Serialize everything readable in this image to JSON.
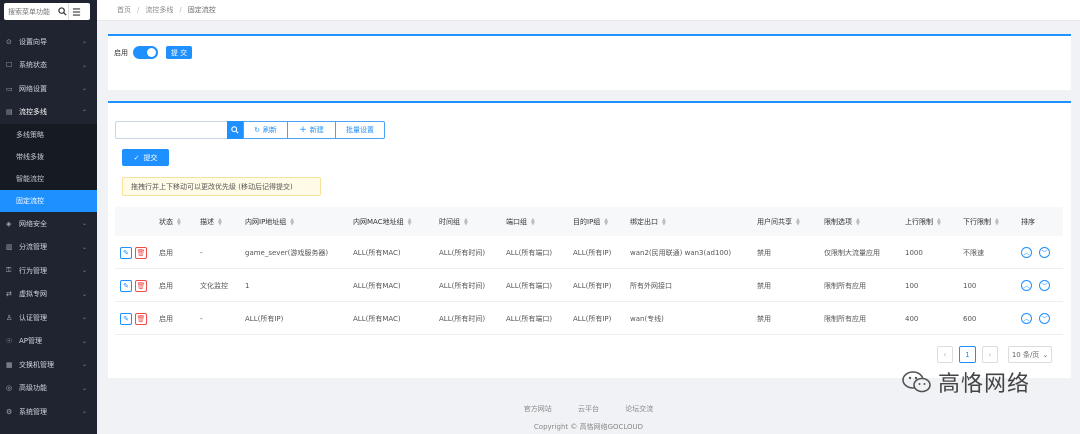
{
  "sidebar": {
    "search_placeholder": "搜索菜单功能",
    "menu": [
      {
        "icon": "gear-icon",
        "glyph": "⊙",
        "label": "设置向导"
      },
      {
        "icon": "status-icon",
        "glyph": "☐",
        "label": "系统状态"
      },
      {
        "icon": "network-icon",
        "glyph": "▭",
        "label": "网络设置"
      },
      {
        "icon": "flow-icon",
        "glyph": "▤",
        "label": "流控多线"
      }
    ],
    "submenu": [
      {
        "label": "多线策略"
      },
      {
        "label": "带线多拨"
      },
      {
        "label": "智能流控"
      },
      {
        "label": "固定流控"
      }
    ],
    "menu_after": [
      {
        "icon": "shield-icon",
        "glyph": "◈",
        "label": "网络安全"
      },
      {
        "icon": "split-icon",
        "glyph": "▥",
        "label": "分流管理"
      },
      {
        "icon": "behavior-icon",
        "glyph": "⚿",
        "label": "行为管理"
      },
      {
        "icon": "vpn-icon",
        "glyph": "⇄",
        "label": "虚拟专网"
      },
      {
        "icon": "auth-icon",
        "glyph": "♙",
        "label": "认证管理"
      },
      {
        "icon": "ap-icon",
        "glyph": "☉",
        "label": "AP管理"
      },
      {
        "icon": "switch-icon",
        "glyph": "▦",
        "label": "交换机管理"
      },
      {
        "icon": "advanced-icon",
        "glyph": "◎",
        "label": "高级功能"
      },
      {
        "icon": "system-icon",
        "glyph": "⚙",
        "label": "系统管理"
      }
    ]
  },
  "breadcrumb": {
    "home": "首页",
    "parent": "流控多线",
    "current": "固定流控"
  },
  "top_card": {
    "enable_label": "启用",
    "submit_label": "提 交"
  },
  "toolbar": {
    "refresh_label": "刷新",
    "new_label": "新建",
    "batch_label": "批量设置"
  },
  "submit_label": "提交",
  "notice": "拖拽行并上下移动可以更改优先级 (移动后记得提交)",
  "table": {
    "headers": [
      "状态",
      "描述",
      "内网IP地址组",
      "内网MAC地址组",
      "时间组",
      "端口组",
      "目的IP组",
      "绑定出口",
      "用户间共享",
      "限制选项",
      "上行限制",
      "下行限制",
      "排序"
    ],
    "rows": [
      [
        "启用",
        "-",
        "game_sever(游戏服务器)",
        "ALL(所有MAC)",
        "ALL(所有时间)",
        "ALL(所有端口)",
        "ALL(所有IP)",
        "wan2(民用联通) wan3(ad100)",
        "禁用",
        "仅限制大流量应用",
        "1000",
        "不限速"
      ],
      [
        "启用",
        "文化监控",
        "1",
        "ALL(所有MAC)",
        "ALL(所有时间)",
        "ALL(所有端口)",
        "ALL(所有IP)",
        "所有外网接口",
        "禁用",
        "限制所有应用",
        "100",
        "100"
      ],
      [
        "启用",
        "-",
        "ALL(所有IP)",
        "ALL(所有MAC)",
        "ALL(所有时间)",
        "ALL(所有端口)",
        "ALL(所有IP)",
        "wan(专线)",
        "禁用",
        "限制所有应用",
        "400",
        "600"
      ]
    ]
  },
  "pager": {
    "page": "1",
    "size": "10 条/页"
  },
  "footer": {
    "links": [
      "官方网站",
      "云平台",
      "论坛交流"
    ],
    "copyright": "Copyright © 高恪网络GOCLOUD"
  },
  "watermark": "高恪网络",
  "colors": {
    "accent": "#1e90ff",
    "sidebar": "#1f2430",
    "danger": "#f04b4b"
  }
}
